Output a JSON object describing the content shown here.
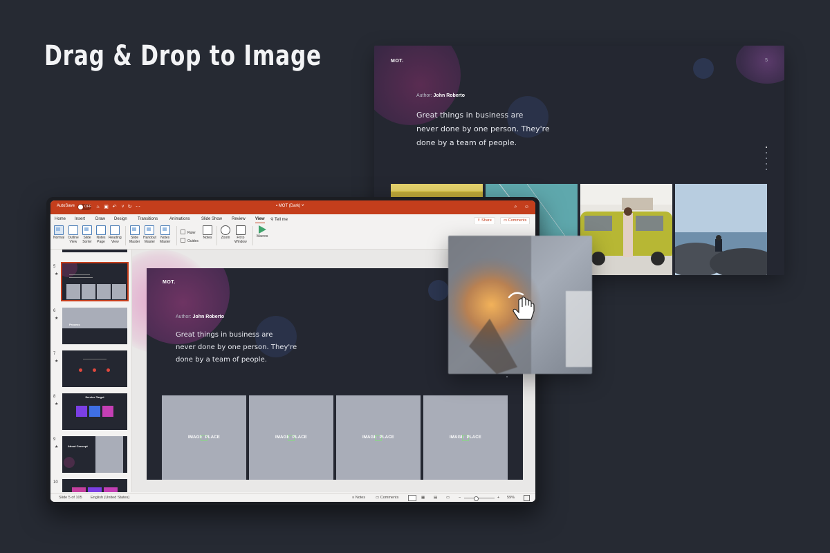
{
  "headline": "Drag & Drop to Image",
  "preview": {
    "logo": "MOT.",
    "page_number": "5",
    "author_label": "Author:",
    "author_name": "John Roberto",
    "quote_lines": [
      "Great things in business are",
      "never done by one person. They're",
      "done by a team of people."
    ]
  },
  "app": {
    "autosave_label": "AutoSave",
    "autosave_state": "OFF",
    "document_title": "MOT (Dark)",
    "menu": [
      "Home",
      "Insert",
      "Draw",
      "Design",
      "Transitions",
      "Animations",
      "Slide Show",
      "Review",
      "View"
    ],
    "active_menu": "View",
    "tell_me": "Tell me",
    "share_label": "Share",
    "comments_label": "Comments",
    "ribbon": {
      "normal": "Normal",
      "outline_view": [
        "Outline",
        "View"
      ],
      "slide_sorter": [
        "Slide",
        "Sorter"
      ],
      "notes_page": [
        "Notes",
        "Page"
      ],
      "reading_view": [
        "Reading",
        "View"
      ],
      "slide_master": [
        "Slide",
        "Master"
      ],
      "handout_master": [
        "Handout",
        "Master"
      ],
      "notes_master": [
        "Notes",
        "Master"
      ],
      "ruler": "Ruler",
      "guides": "Guides",
      "notes": "Notes",
      "zoom": "Zoom",
      "fit_to_window": [
        "Fit to",
        "Window"
      ],
      "macros": "Macros"
    },
    "thumbnails": [
      {
        "number": "5",
        "title": ""
      },
      {
        "number": "6",
        "title": "Process"
      },
      {
        "number": "7",
        "title": ""
      },
      {
        "number": "8",
        "title": "Service Target"
      },
      {
        "number": "9",
        "title": "About Concept"
      },
      {
        "number": "10",
        "title": ""
      }
    ],
    "slide": {
      "logo": "MOT.",
      "author_label": "Author:",
      "author_name": "John Roberto",
      "quote_lines": [
        "Great things in business are",
        "never done by one person. They're",
        "done by a team of people."
      ],
      "placeholder_left": "IMAGE",
      "placeholder_right": "PLACE"
    },
    "status": {
      "slide_count": "Slide 5 of 105",
      "language": "English (United States)",
      "notes": "Notes",
      "comments": "Comments",
      "zoom": "59%"
    }
  },
  "colors": {
    "accent": "#c43e1c",
    "background": "#262a33",
    "slide_bg": "#242731",
    "placeholder": "#a9adb8"
  }
}
